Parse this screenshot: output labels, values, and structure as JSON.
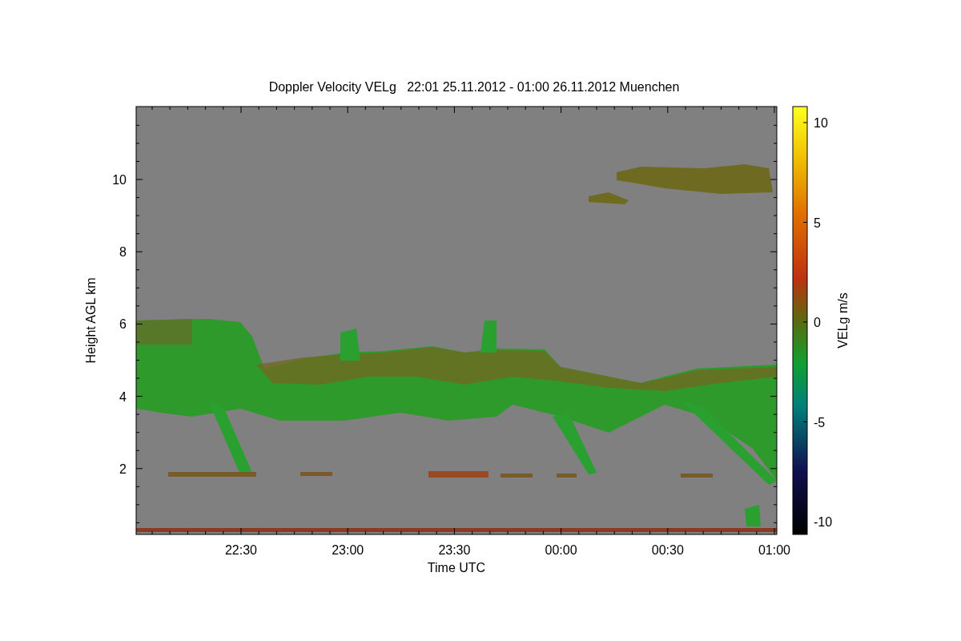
{
  "title": "Doppler Velocity VELg   22:01 25.11.2012 - 01:00 26.11.2012 Muenchen",
  "y_axis": {
    "label": "Height AGL km",
    "ticks": [
      "10",
      "8",
      "6",
      "4",
      "2"
    ]
  },
  "x_axis": {
    "label": "Time UTC",
    "ticks": [
      "22:30",
      "23:00",
      "23:30",
      "00:00",
      "00:30",
      "01:00"
    ]
  },
  "colorbar": {
    "label": "VELg m/s",
    "ticks": [
      "10",
      "5",
      "0",
      "-5",
      "-10"
    ]
  }
}
